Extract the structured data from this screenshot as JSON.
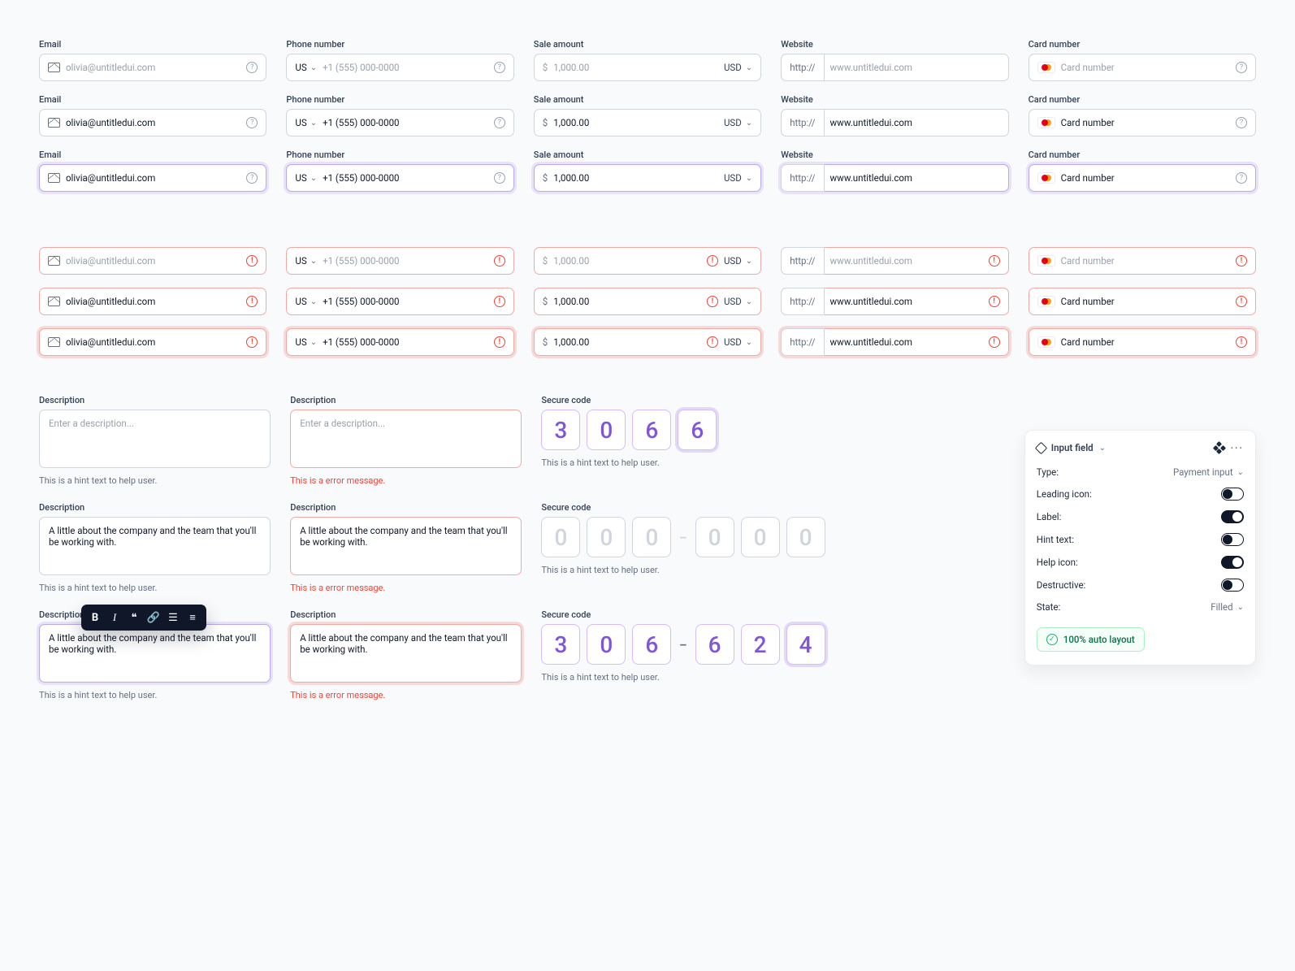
{
  "labels": {
    "email": "Email",
    "phone": "Phone number",
    "sale": "Sale amount",
    "website": "Website",
    "card": "Card number",
    "description": "Description",
    "secureCode": "Secure code"
  },
  "values": {
    "email": "olivia@untitledui.com",
    "phonePrefix": "US",
    "phone": "+1 (555) 000-0000",
    "saleSymbol": "$",
    "saleAmount": "1,000.00",
    "saleCurrency": "USD",
    "siteProtocol": "http://",
    "site": "www.untitledui.com",
    "card": "Card number",
    "textareaPlaceholder": "Enter a description...",
    "textareaFilled": "A little about the company and the team that you'll be working with.",
    "code4": [
      "3",
      "0",
      "6",
      "6"
    ],
    "code6empty": [
      "0",
      "0",
      "0",
      "0",
      "0",
      "0"
    ],
    "code6": [
      "3",
      "0",
      "6",
      "6",
      "2",
      "4"
    ]
  },
  "messages": {
    "hint": "This is a hint text to help user.",
    "error": "This is a error message."
  },
  "inspector": {
    "title": "Input field",
    "rows": {
      "type": "Type:",
      "leadingIcon": "Leading icon:",
      "label": "Label:",
      "hintText": "Hint text:",
      "helpIcon": "Help icon:",
      "destructive": "Destructive:",
      "state": "State:"
    },
    "typeValue": "Payment input",
    "stateValue": "Filled",
    "toggles": {
      "leadingIcon": false,
      "label": true,
      "hintText": false,
      "helpIcon": true,
      "destructive": false
    },
    "badge": "100% auto layout"
  }
}
